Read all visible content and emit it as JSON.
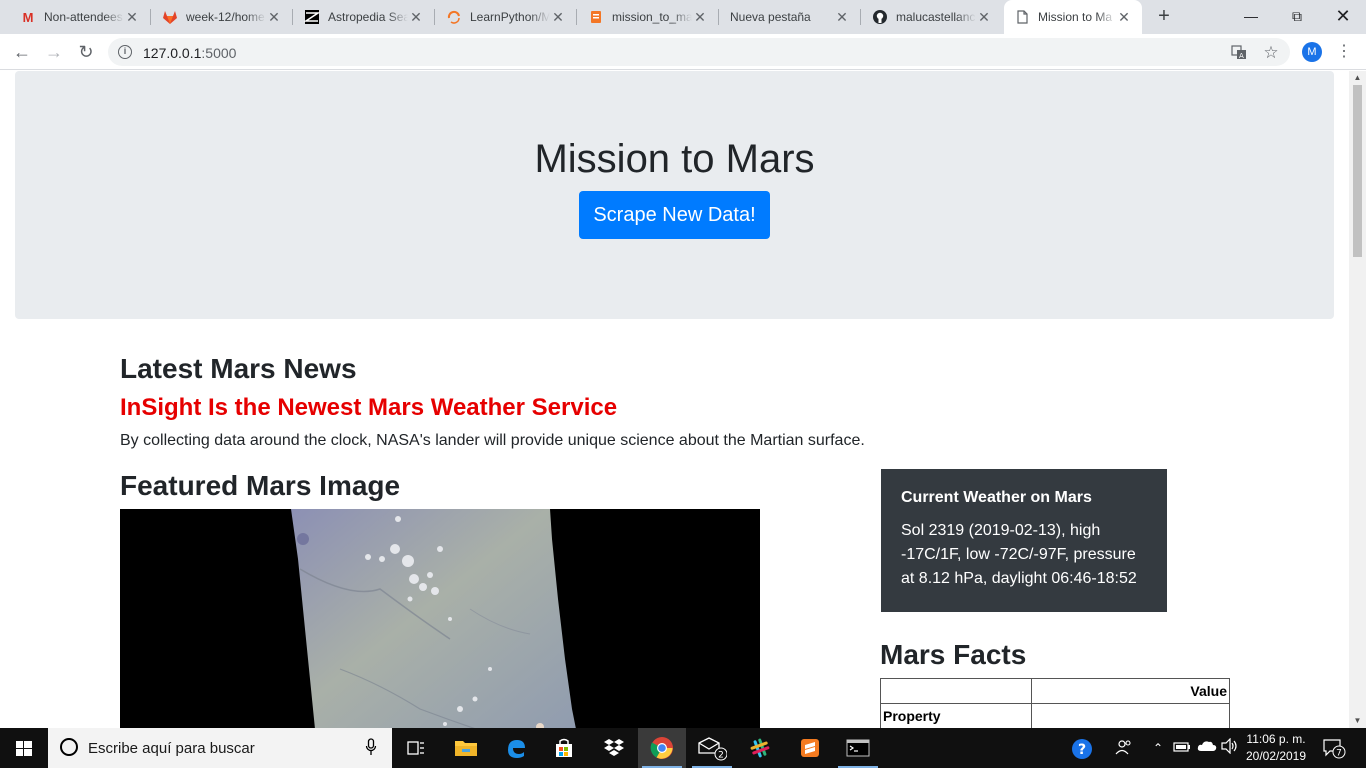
{
  "browser": {
    "tabs": [
      {
        "title": "Non-attendees",
        "icon": "gmail-icon",
        "color": "#d93025"
      },
      {
        "title": "week-12/home",
        "icon": "gitlab-icon",
        "color": "#e24329"
      },
      {
        "title": "Astropedia Sea",
        "icon": "astropedia-icon",
        "color": "#000000"
      },
      {
        "title": "LearnPython/M",
        "icon": "learnpython-icon",
        "color": "#f37626"
      },
      {
        "title": "mission_to_ma",
        "icon": "notebook-icon",
        "color": "#f37626"
      },
      {
        "title": "Nueva pestaña",
        "icon": "",
        "color": ""
      },
      {
        "title": "malucastellanc",
        "icon": "github-icon",
        "color": "#24292e"
      },
      {
        "title": "Mission to Ma",
        "icon": "page-icon",
        "color": "#5f6368"
      }
    ],
    "url_host": "127.0.0.1",
    "url_port": ":5000",
    "profile_initial": "M"
  },
  "page": {
    "title": "Mission to Mars",
    "scrape_button": "Scrape New Data!",
    "news_heading": "Latest Mars News",
    "news_title": "InSight Is the Newest Mars Weather Service",
    "news_body": "By collecting data around the clock, NASA's lander will provide unique science about the Martian surface.",
    "featured_heading": "Featured Mars Image",
    "weather_title": "Current Weather on Mars",
    "weather_text": "Sol 2319 (2019-02-13), high -17C/1F, low -72C/-97F, pressure at 8.12 hPa, daylight 06:46-18:52",
    "facts_heading": "Mars Facts",
    "facts_header_value": "Value",
    "facts_row_property": "Property"
  },
  "taskbar": {
    "search_placeholder": "Escribe aquí para buscar",
    "mail_badge": "2",
    "time": "11:06 p. m.",
    "date": "20/02/2019",
    "notifications_count": "7"
  },
  "colors": {
    "accent": "#007bff",
    "news_title": "#e60000",
    "weather_card": "#343a40",
    "jumbotron": "#e9ecef"
  }
}
